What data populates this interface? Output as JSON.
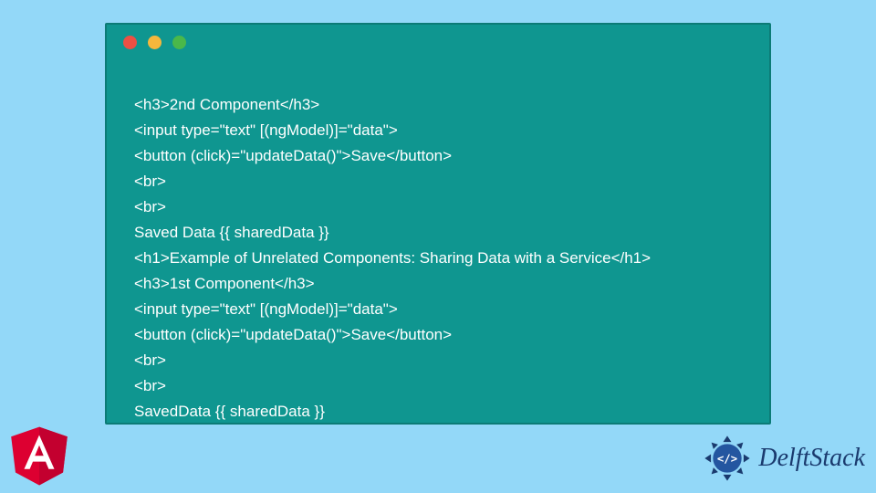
{
  "code": {
    "lines": [
      "<h3>2nd Component</h3>",
      "<input type=\"text\" [(ngModel)]=\"data\">",
      "<button (click)=\"updateData()\">Save</button>",
      "<br>",
      "<br>",
      "Saved Data {{ sharedData }}",
      "<h1>Example of Unrelated Components: Sharing Data with a Service</h1>",
      "<h3>1st Component</h3>",
      "<input type=\"text\" [(ngModel)]=\"data\">",
      "<button (click)=\"updateData()\">Save</button>",
      "<br>",
      "<br>",
      "SavedData {{ sharedData }}"
    ]
  },
  "logos": {
    "angular": "A",
    "delftstack": "DelftStack"
  },
  "colors": {
    "background": "#93d8f8",
    "codeBg": "#0f9690",
    "red": "#ec5044",
    "yellow": "#f6b73c",
    "green": "#4ab84a",
    "delftBlue": "#1a3a6e"
  }
}
